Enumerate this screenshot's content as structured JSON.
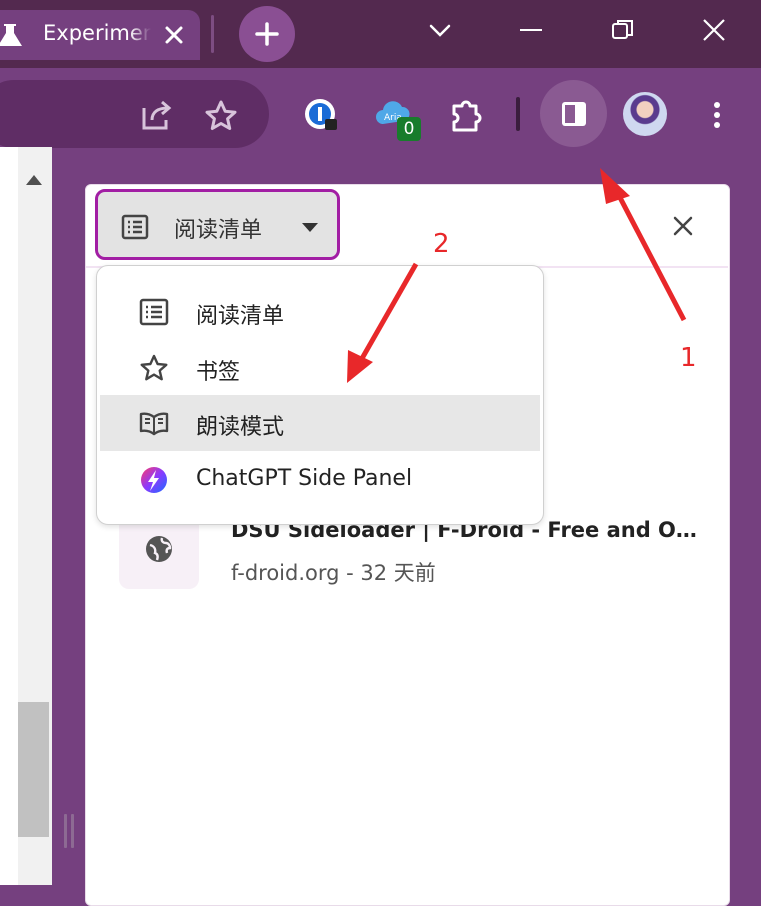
{
  "tab": {
    "title": "Experimental",
    "close_icon": "close-icon",
    "tab_icon": "flask-icon"
  },
  "window": {
    "new_tab_icon": "plus-icon",
    "dropdown_icon": "chevron-down-icon",
    "minimize_icon": "minimize-icon",
    "restore_icon": "restore-icon",
    "close_icon": "close-icon"
  },
  "toolbar": {
    "share_icon": "share-icon",
    "bookmark_icon": "star-icon",
    "extensions": [
      {
        "name": "1password-extension-icon"
      },
      {
        "name": "aria-extension-icon",
        "badge": "0"
      },
      {
        "name": "puzzle-extensions-icon"
      }
    ],
    "side_panel_icon": "side-panel-icon",
    "avatar": "profile-avatar",
    "menu_icon": "kebab-menu-icon"
  },
  "side_panel": {
    "selector_label": "阅读清单",
    "menu_items": [
      {
        "label": "阅读清单",
        "icon": "list-icon",
        "selected": false
      },
      {
        "label": "书签",
        "icon": "star-outline-icon",
        "selected": false
      },
      {
        "label": "朗读模式",
        "icon": "book-open-icon",
        "selected": true
      },
      {
        "label": "ChatGPT Side Panel",
        "icon": "chatgpt-sidepanel-icon",
        "selected": false
      }
    ],
    "reading_item": {
      "title": "DSU Sideloader | F-Droid - Free and Open Source Android App Repository",
      "subtitle": "f-droid.org - 32 天前"
    }
  },
  "annotations": {
    "label_1": "1",
    "label_2": "2",
    "color": "#e8282a"
  },
  "colors": {
    "frame": "#53294f",
    "toolbar": "#75407f",
    "accent_border": "#a21ea4"
  }
}
